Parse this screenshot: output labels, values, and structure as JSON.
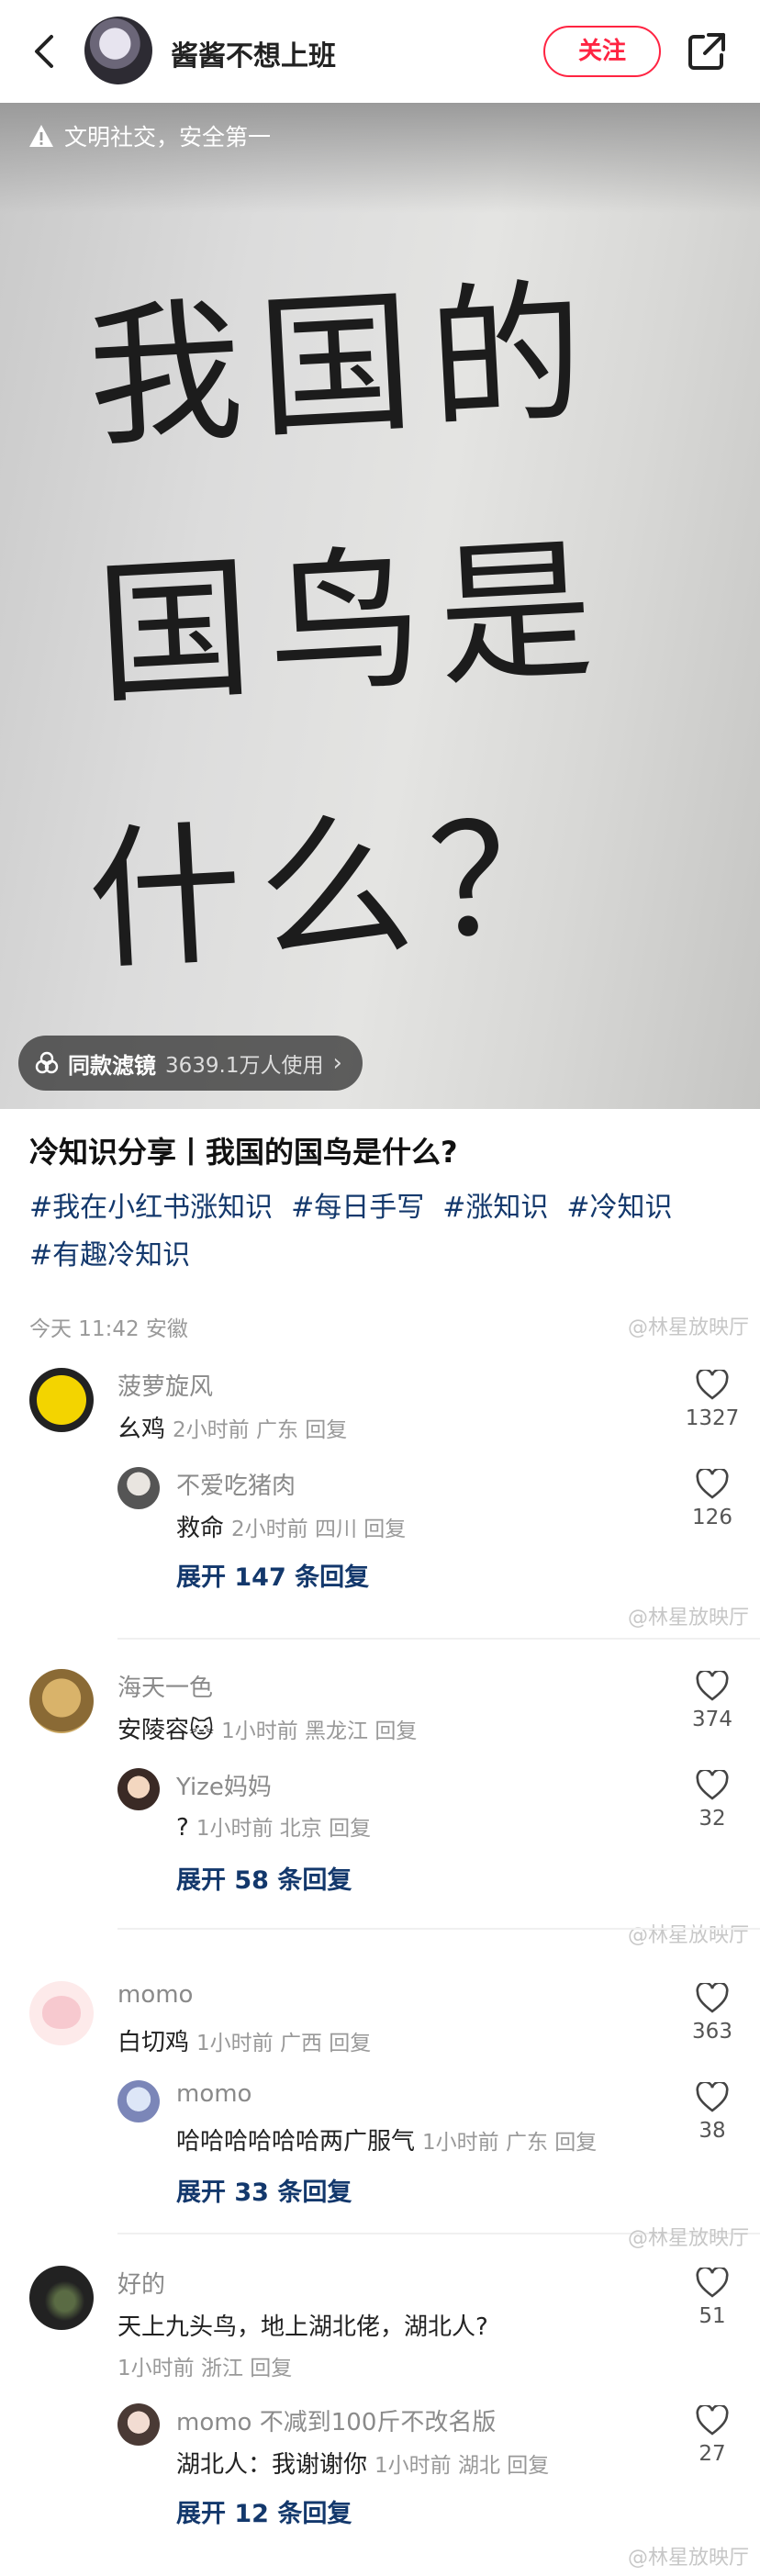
{
  "header": {
    "author_name": "酱酱不想上班",
    "follow_label": "关注"
  },
  "image": {
    "warning": "文明社交，安全第一",
    "handwriting": [
      "我国的",
      "国鸟是",
      "什么？"
    ],
    "filter_name": "同款滤镜",
    "filter_usage": "3639.1万人使用"
  },
  "post": {
    "title": "冷知识分享丨我国的国鸟是什么?",
    "tags": [
      "#我在小红书涨知识",
      "#每日手写",
      "#涨知识",
      "#冷知识",
      "#有趣冷知识"
    ],
    "meta": "今天 11:42 安徽"
  },
  "watermark": "@林星放映厅",
  "comments": [
    {
      "name": "菠萝旋风",
      "text": "幺鸡",
      "sub": "2小时前 广东 回复",
      "likes": "1327",
      "reply": {
        "name": "不爱吃猪肉",
        "text": "救命",
        "sub": "2小时前 四川 回复",
        "likes": "126"
      },
      "expand": "展开 147 条回复"
    },
    {
      "name": "海天一色",
      "text": "安陵容🐱",
      "sub": "1小时前 黑龙江 回复",
      "likes": "374",
      "reply": {
        "name": "Yize妈妈",
        "text": "?",
        "sub": "1小时前 北京 回复",
        "likes": "32"
      },
      "expand": "展开 58 条回复"
    },
    {
      "name": "momo",
      "text": "白切鸡",
      "sub": "1小时前 广西 回复",
      "likes": "363",
      "reply": {
        "name": "momo",
        "text": "哈哈哈哈哈哈两广服气",
        "sub": "1小时前 广东 回复",
        "likes": "38"
      },
      "expand": "展开 33 条回复"
    },
    {
      "name": "好的",
      "text": "天上九头鸟，地上湖北佬，湖北人?",
      "sub": "1小时前 浙江 回复",
      "likes": "51",
      "reply": {
        "name": "momo 不减到100斤不改名版",
        "text": "湖北人：我谢谢你",
        "sub": "1小时前 湖北 回复",
        "likes": "27"
      },
      "expand": "展开 12 条回复"
    }
  ]
}
